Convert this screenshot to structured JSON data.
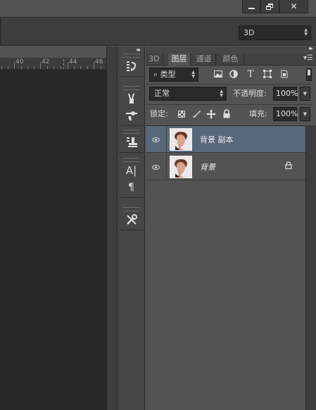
{
  "titlebar": {
    "minimize_icon": "minimize-icon",
    "restore_icon": "restore-icon",
    "close_icon": "close-icon"
  },
  "options_bar": {
    "workspace_mode": "3D"
  },
  "ruler": {
    "ticks": [
      "40",
      "42",
      "44",
      "46"
    ]
  },
  "toolstrip": {
    "groups": [
      {
        "tools": [
          "history-brush-icon"
        ]
      },
      {
        "tools": [
          "brush-presets-icon",
          "brush-settings-icon"
        ]
      },
      {
        "tools": [
          "clone-source-icon"
        ]
      },
      {
        "tools": [
          "character-icon",
          "paragraph-icon"
        ]
      },
      {
        "tools": [
          "tools-settings-icon"
        ]
      }
    ]
  },
  "layers_panel": {
    "tabs": [
      {
        "label": "3D",
        "active": false
      },
      {
        "label": "图层",
        "active": true
      },
      {
        "label": "通道",
        "active": false
      },
      {
        "label": "颜色",
        "active": false
      }
    ],
    "filter": {
      "kind_label": "类型",
      "icons": [
        "image-filter-icon",
        "adjustment-filter-icon",
        "type-filter-icon",
        "shape-filter-icon",
        "smart-object-filter-icon"
      ]
    },
    "blend_mode": "正常",
    "opacity_label": "不透明度:",
    "opacity_value": "100%",
    "lock_label": "锁定:",
    "lock_icons": [
      "lock-transparent-icon",
      "lock-image-icon",
      "lock-position-icon",
      "lock-all-icon"
    ],
    "fill_label": "填充:",
    "fill_value": "100%",
    "layers": [
      {
        "name": "背景 副本",
        "selected": true,
        "visible": true,
        "locked": false,
        "italic": false
      },
      {
        "name": "背景",
        "selected": false,
        "visible": true,
        "locked": true,
        "italic": true
      }
    ]
  }
}
